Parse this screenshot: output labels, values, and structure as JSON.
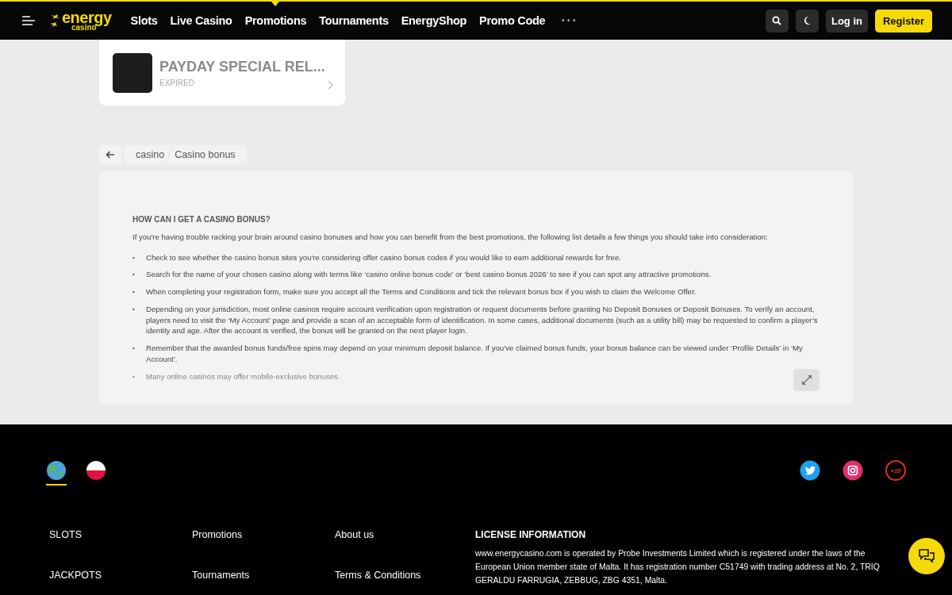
{
  "header": {
    "logo": {
      "word": "energy",
      "sub": "casino"
    },
    "nav": [
      {
        "label": "Slots",
        "selected": false
      },
      {
        "label": "Live Casino",
        "selected": false
      },
      {
        "label": "Promotions",
        "selected": true
      },
      {
        "label": "Tournaments",
        "selected": false
      },
      {
        "label": "EnergyShop",
        "selected": false
      },
      {
        "label": "Promo Code",
        "selected": false
      }
    ],
    "more": "···",
    "login": "Log in",
    "register": "Register"
  },
  "promo_card": {
    "title": "PAYDAY SPECIAL REL...",
    "status": "EXPIRED"
  },
  "breadcrumb": [
    "casino",
    "Casino bonus"
  ],
  "article": {
    "heading": "HOW CAN I GET A CASINO BONUS?",
    "bullet_marker": "•",
    "intro": "If you're having trouble racking your brain around casino bonuses and how you can benefit from the best promotions, the following list details a few things you should take into consideration:",
    "bullets": [
      "Check to see whether the casino bonus sites you're considering offer casino bonus codes if you would like to earn additional rewards for free.",
      "Search for the name of your chosen casino along with terms like ‘casino online bonus code’ or ‘best casino bonus 2026’ to see if you can spot any attractive promotions.",
      "When completing your registration form, make sure you accept all the Terms and Conditions and tick the relevant bonus box if you wish to claim the Welcome Offer.",
      "Depending on your jurisdiction, most online casinos require account verification upon registration or request documents before granting No Deposit Bonuses or Deposit Bonuses. To verify an account, players need to visit the ‘My Account’ page and provide a scan of an acceptable form of identification. In some cases, additional documents (such as a utility bill) may be requested to confirm a player’s identity and age. After the account is verified, the bonus will be granted on the next player login.",
      "Remember that the awarded bonus funds/free spins may depend on your minimum deposit balance. If you’ve claimed bonus funds, your bonus balance can be viewed under ‘Profile Details’ in ‘My Account’.",
      "Many online casinos may offer mobile-exclusive bonuses."
    ]
  },
  "footer": {
    "languages": [
      {
        "kind": "globe",
        "selected": true
      },
      {
        "kind": "poland",
        "selected": false
      }
    ],
    "age_badge": "+18",
    "columns": [
      [
        "SLOTS",
        "JACKPOTS"
      ],
      [
        "Promotions",
        "Tournaments"
      ],
      [
        "About us",
        "Terms & Conditions"
      ]
    ],
    "license_title": "LICENSE INFORMATION",
    "license_text": "www.energycasino.com is operated by Probe Investments Limited which is registered under the laws of the European Union member state of Malta. It has registration number C51749 with trading address at No. 2, TRIQ GERALDU FARRUGIA, ZEBBUG, ZBG 4351, Malta."
  }
}
